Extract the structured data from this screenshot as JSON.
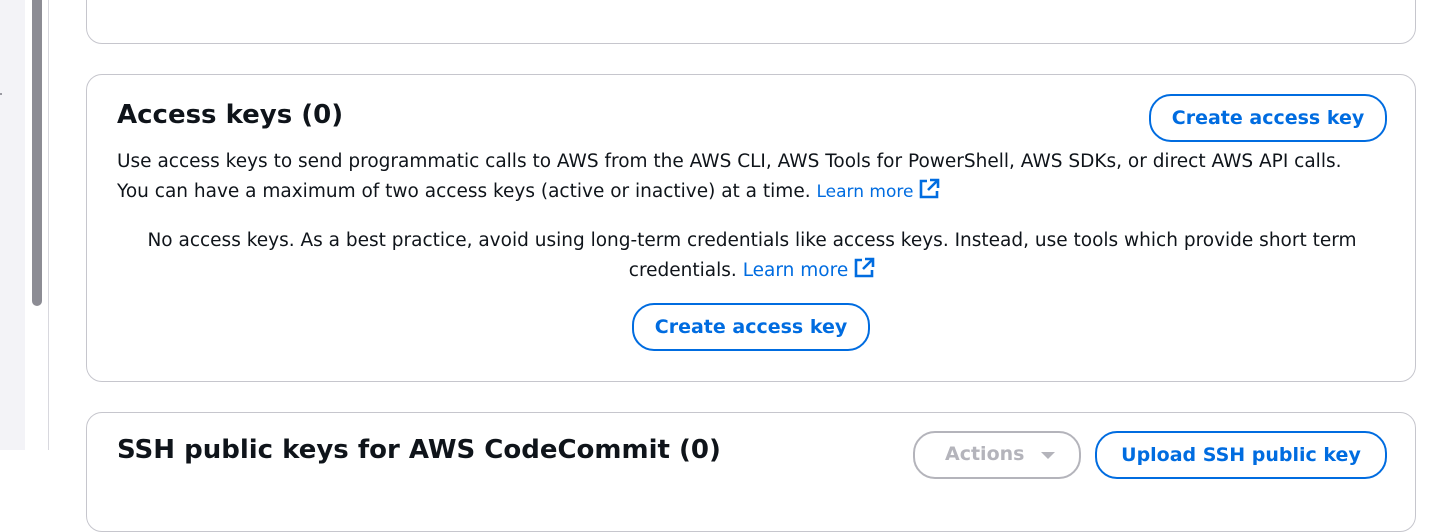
{
  "access_keys": {
    "title": "Access keys (0)",
    "create_button_label": "Create access key",
    "description_line1": "Use access keys to send programmatic calls to AWS from the AWS CLI, AWS Tools for PowerShell, AWS SDKs, or direct AWS API calls.",
    "description_line2": "You can have a maximum of two access keys (active or inactive) at a time.",
    "learn_more_label": "Learn more",
    "empty_message": "No access keys. As a best practice, avoid using long-term credentials like access keys. Instead, use tools which provide short term credentials.",
    "empty_learn_more_label": "Learn more",
    "empty_create_button_label": "Create access key"
  },
  "ssh_keys": {
    "title": "SSH public keys for AWS CodeCommit (0)",
    "actions_label": "Actions",
    "upload_button_label": "Upload SSH public key"
  },
  "icons": {
    "external_link": "external-link-icon",
    "caret_down": "caret-down-icon"
  },
  "colors": {
    "accent": "#006ce0",
    "text": "#0f141a",
    "border": "#c6c6cd",
    "disabled": "#b4b4bb"
  }
}
